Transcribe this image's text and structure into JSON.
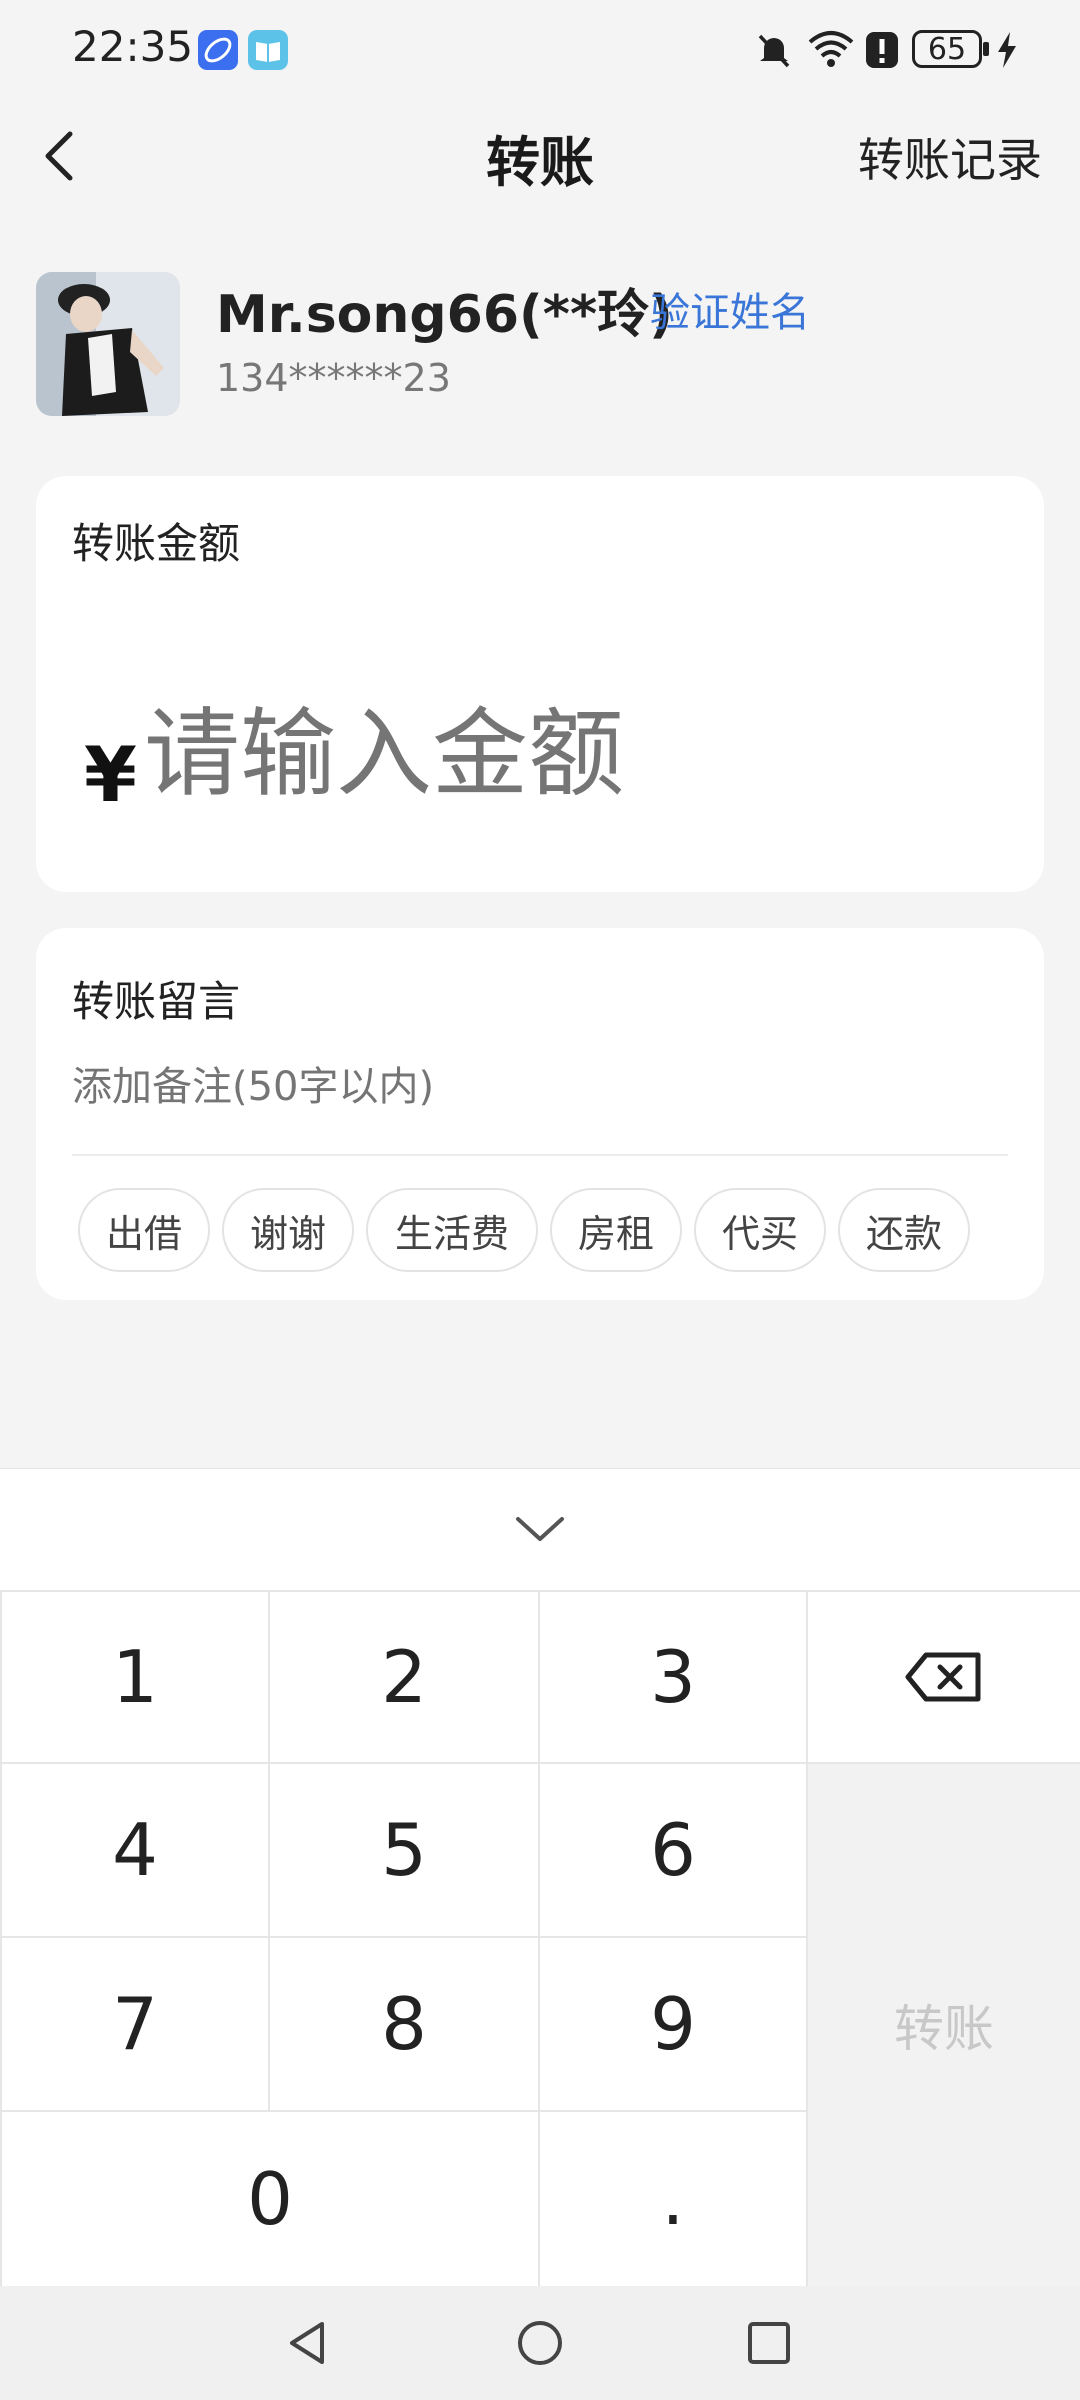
{
  "status_bar": {
    "time": "22:35",
    "battery": "65"
  },
  "nav": {
    "title": "转账",
    "right_action": "转账记录"
  },
  "payee": {
    "name": "Mr.song66(**玲)",
    "verify_link": "验证姓名",
    "phone": "134******23"
  },
  "amount_card": {
    "title": "转账金额",
    "currency": "¥",
    "placeholder": "请输入金额"
  },
  "remark_card": {
    "title": "转账留言",
    "placeholder": "添加备注(50字以内)",
    "chips": [
      "出借",
      "谢谢",
      "生活费",
      "房租",
      "代买",
      "还款"
    ]
  },
  "keypad": {
    "keys": [
      "1",
      "2",
      "3",
      "4",
      "5",
      "6",
      "7",
      "8",
      "9",
      "0",
      "."
    ],
    "transfer_label": "转账"
  },
  "icons": {
    "back": "chevron-left-icon",
    "collapse": "chevron-down-icon",
    "delete": "backspace-icon",
    "nav_back": "triangle-back-icon",
    "nav_home": "circle-home-icon",
    "nav_recents": "square-recents-icon"
  }
}
